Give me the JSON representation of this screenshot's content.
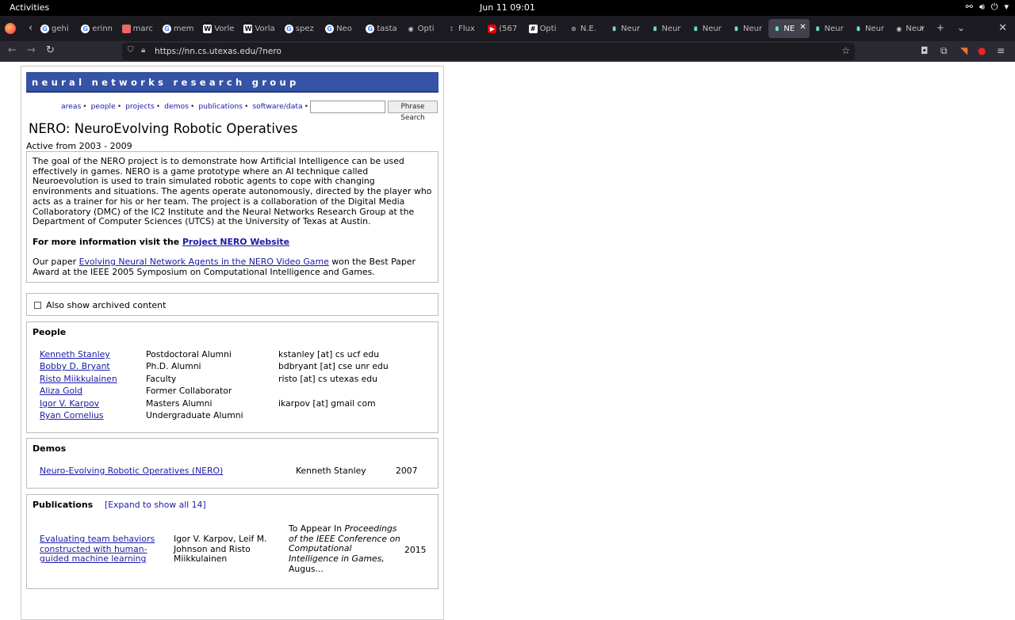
{
  "topbar": {
    "activities": "Activities",
    "clock": "Jun 11  09:01"
  },
  "tabs": [
    {
      "icon": "google",
      "title": "gehi"
    },
    {
      "icon": "google",
      "title": "erinn"
    },
    {
      "icon": "pdf",
      "title": "marc"
    },
    {
      "icon": "google",
      "title": "mem"
    },
    {
      "icon": "wikipedia",
      "title": "Vorle"
    },
    {
      "icon": "wikipedia",
      "title": "Vorla"
    },
    {
      "icon": "google",
      "title": "spez"
    },
    {
      "icon": "google",
      "title": "Neo"
    },
    {
      "icon": "google",
      "title": "tasta"
    },
    {
      "icon": "eye",
      "title": "Opti"
    },
    {
      "icon": "flux",
      "title": "Flux"
    },
    {
      "icon": "youtube",
      "title": "(567"
    },
    {
      "icon": "hash",
      "title": "Opti"
    },
    {
      "icon": "ne",
      "title": "N.E."
    },
    {
      "icon": "nn",
      "title": "Neur"
    },
    {
      "icon": "nn",
      "title": "Neur"
    },
    {
      "icon": "nn",
      "title": "Neur"
    },
    {
      "icon": "nn",
      "title": "Neur"
    },
    {
      "icon": "nn",
      "title": "NE",
      "active": true
    },
    {
      "icon": "nn",
      "title": "Neur"
    },
    {
      "icon": "nn",
      "title": "Neur"
    },
    {
      "icon": "eye",
      "title": "Neur"
    }
  ],
  "navbar": {
    "url": "https://nn.cs.utexas.edu/?nero"
  },
  "site": {
    "banner": "neural networks research group",
    "nav": [
      "areas",
      "people",
      "projects",
      "demos",
      "publications",
      "software/data"
    ],
    "search_button": "Phrase Search",
    "search_value": ""
  },
  "project": {
    "title": "NERO: NeuroEvolving Robotic Operatives",
    "active": "Active from 2003 - 2009",
    "description": "The goal of the NERO project is to demonstrate how Artificial Intelligence can be used effectively in games. NERO is a game prototype where an AI technique called Neuroevolution is used to train simulated robotic agents to cope with changing environments and situations. The agents operate autonomously, directed by the player who acts as a trainer for his or her team. The project is a collaboration of the Digital Media Collaboratory (DMC) of the IC2 Institute and the Neural Networks Research Group at the Department of Computer Sciences (UTCS) at the University of Texas at Austin.",
    "more_info_prefix": "For more information visit the ",
    "more_info_link": "Project NERO Website",
    "paper_prefix": "Our paper ",
    "paper_link": "Evolving Neural Network Agents in the NERO Video Game",
    "paper_suffix": " won the Best Paper Award at the IEEE 2005 Symposium on Computational Intelligence and Games."
  },
  "archived": {
    "label": "Also show archived content",
    "checked": false
  },
  "people": {
    "heading": "People",
    "rows": [
      {
        "name": "Kenneth Stanley",
        "role": "Postdoctoral Alumni",
        "email": "kstanley [at] cs ucf edu"
      },
      {
        "name": "Bobby D. Bryant",
        "role": "Ph.D. Alumni",
        "email": "bdbryant [at] cse unr edu"
      },
      {
        "name": "Risto Miikkulainen",
        "role": "Faculty",
        "email": "risto [at] cs utexas edu"
      },
      {
        "name": "Aliza Gold",
        "role": "Former Collaborator",
        "email": ""
      },
      {
        "name": "Igor V. Karpov",
        "role": "Masters Alumni",
        "email": "ikarpov [at] gmail com"
      },
      {
        "name": "Ryan Cornelius",
        "role": "Undergraduate Alumni",
        "email": ""
      }
    ]
  },
  "demos": {
    "heading": "Demos",
    "rows": [
      {
        "title": "Neuro-Evolving Robotic Operatives (NERO)",
        "author": "Kenneth Stanley",
        "year": "2007"
      }
    ]
  },
  "publications": {
    "heading": "Publications",
    "expand": "[Expand to show all 14]",
    "rows": [
      {
        "title": "Evaluating team behaviors constructed with human-guided machine learning",
        "authors": "Igor V. Karpov, Leif M. Johnson and Risto Miikkulainen",
        "venue_prefix": "To Appear In ",
        "venue": "Proceedings of the IEEE Conference on Computational Intelligence in Games,",
        "venue_suffix": " Augus...",
        "year": "2015"
      }
    ]
  }
}
